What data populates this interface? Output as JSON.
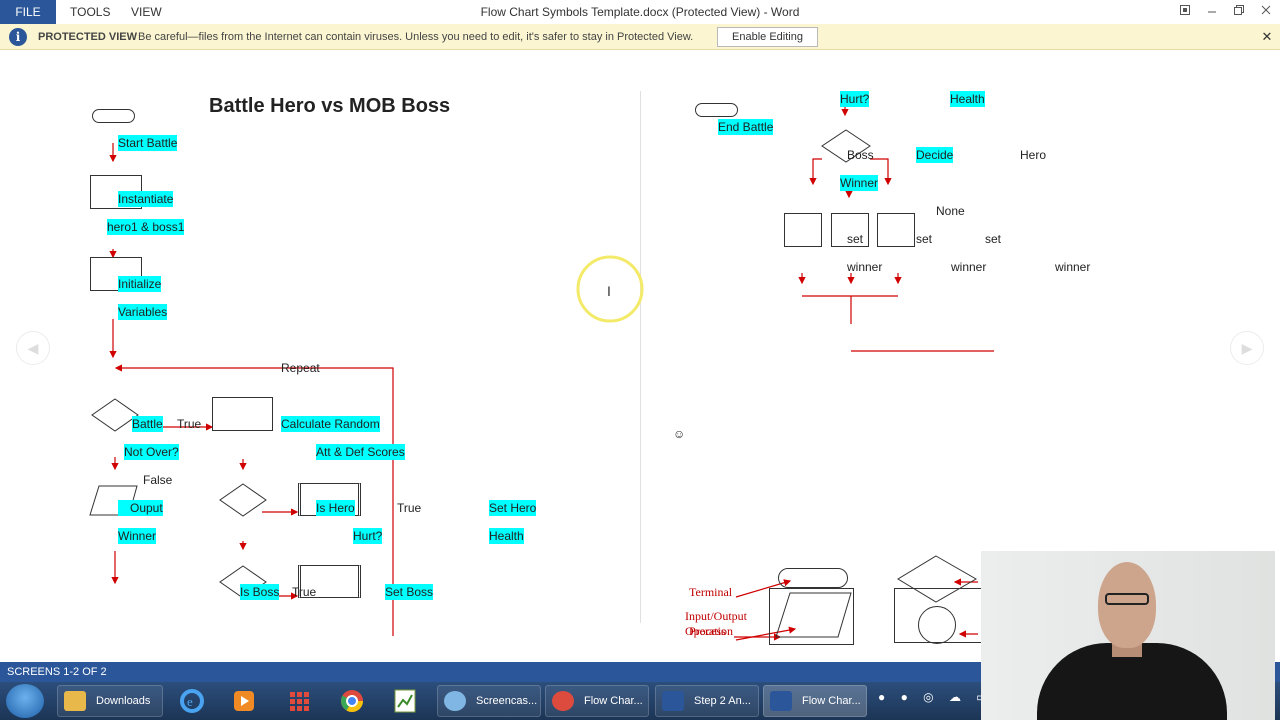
{
  "titlebar": {
    "file": "FILE",
    "tools": "TOOLS",
    "view": "VIEW",
    "document_title": "Flow Chart Symbols Template.docx (Protected View) - Word",
    "icons": [
      "fullscreen-icon",
      "minimize-icon",
      "restore-icon",
      "close-icon"
    ]
  },
  "protected_bar": {
    "title": "PROTECTED VIEW",
    "message": "Be careful—files from the Internet can contain viruses. Unless you need to edit, it's safer to stay in Protected View.",
    "button": "Enable Editing",
    "close": "✕"
  },
  "doc": {
    "heading": "Battle Hero vs MOB Boss",
    "left": {
      "start_battle": "Start Battle",
      "instantiate": "Instantiate",
      "hero_boss": "hero1 & boss1",
      "initialize": "Initialize",
      "variables": "Variables",
      "repeat": "Repeat",
      "battle": "Battle",
      "true1": "True",
      "not_over": "Not Over?",
      "false": "False",
      "ouput": "Ouput",
      "winner": "Winner",
      "calc_random": "Calculate Random",
      "att_def": "Att & Def Scores",
      "is_hero": "Is Hero",
      "true2": "True",
      "hurt1": "Hurt?",
      "set_hero": "Set Hero",
      "health1": "Health",
      "is_boss": "Is Boss",
      "true3": "True",
      "set_boss": "Set Boss"
    },
    "right": {
      "end_battle": "End Battle",
      "hurt2": "Hurt?",
      "health2": "Health",
      "boss": "Boss",
      "decide": "Decide",
      "hero": "Hero",
      "winner_decide": "Winner",
      "none": "None",
      "set1": "set",
      "set2": "set",
      "set3": "set",
      "winner1": "winner",
      "winner2": "winner",
      "winner3": "winner",
      "smiley": "☺"
    },
    "legend": {
      "terminal": "Terminal",
      "input_output": "Input/Output",
      "operation": "Operation",
      "process": "Process"
    }
  },
  "statusbar": {
    "text": "SCREENS 1-2 OF 2"
  },
  "taskbar": {
    "items": [
      {
        "label": "Downloads",
        "color": "#e8b84a"
      },
      {
        "label": "Screencas...",
        "color": "#7fb6e3"
      },
      {
        "label": "Flow Char...",
        "color": "#dd4b3e"
      },
      {
        "label": "Step 2 An...",
        "color": "#2b579a"
      },
      {
        "label": "Flow Char...",
        "color": "#2b579a"
      }
    ],
    "pinned_icons": [
      "internet-explorer-icon",
      "media-player-icon",
      "apps-grid-icon",
      "chrome-icon",
      "spreadsheet-icon"
    ]
  },
  "colors": {
    "word_blue": "#2b579a",
    "highlight": "#00ffff",
    "arrow_red": "#d00000",
    "protected_bg": "#fbf6d1"
  }
}
